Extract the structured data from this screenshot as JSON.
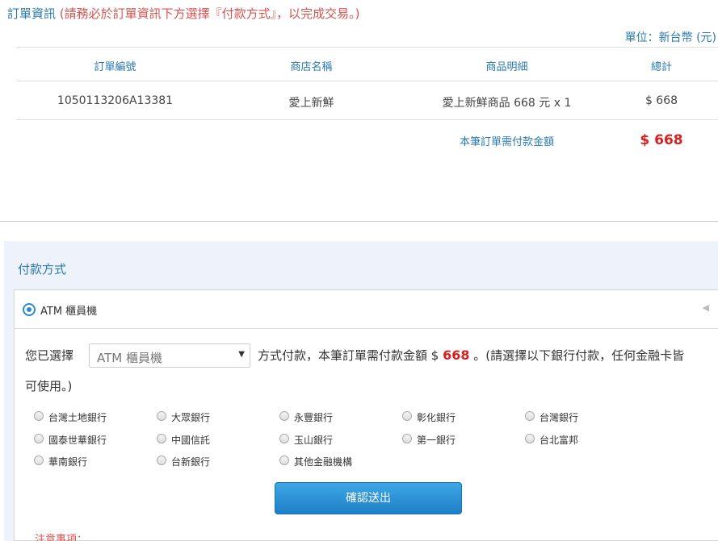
{
  "order_info": {
    "title": "訂單資訊",
    "note": "(請務必於訂單資訊下方選擇『付款方式』，以完成交易。)",
    "unit": "單位：新台幣 (元)",
    "columns": [
      "訂單編號",
      "商店名稱",
      "商品明細",
      "總計"
    ],
    "row": {
      "order_no": "1050113206A13381",
      "store": "愛上新鮮",
      "detail": "愛上新鮮商品 668 元 x 1",
      "total": "$ 668"
    },
    "total_label": "本筆訂單需付款金額",
    "total_amount": "$ 668"
  },
  "payment": {
    "title": "付款方式",
    "method_label": "ATM 櫃員機",
    "select_prefix": "您已選擇",
    "select_value": "ATM 櫃員機",
    "desc_before": "方式付款，本筆訂單需付款金額 $ ",
    "desc_amount": "668",
    "desc_after": " 。(請選擇以下銀行付款，任何金融卡皆",
    "desc_line2": "可使用。)",
    "banks": [
      "台灣土地銀行",
      "大眾銀行",
      "永豐銀行",
      "彰化銀行",
      "台灣銀行",
      "國泰世華銀行",
      "中國信託",
      "玉山銀行",
      "第一銀行",
      "台北富邦",
      "華南銀行",
      "台新銀行",
      "其他金融機構"
    ],
    "confirm_label": "確認送出",
    "notice_title": "注意事項："
  },
  "colors": {
    "accent": "#2a7ab0",
    "alert": "#d92020",
    "button": "#1f7fc6"
  }
}
